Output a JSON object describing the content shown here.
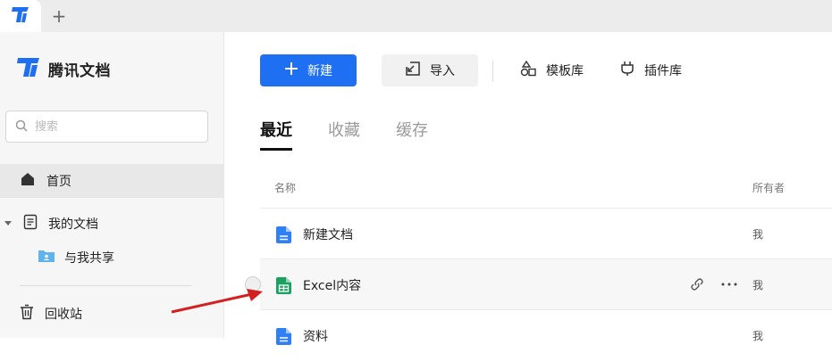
{
  "titlebar": {
    "new_tab_label": "+"
  },
  "sidebar": {
    "brand": "腾讯文档",
    "search_placeholder": "搜索",
    "items": [
      {
        "label": "首页"
      },
      {
        "label": "我的文档"
      },
      {
        "label": "与我共享"
      },
      {
        "label": "回收站"
      }
    ]
  },
  "toolbar": {
    "new_label": "新建",
    "import_label": "导入",
    "templates_label": "模板库",
    "plugins_label": "插件库"
  },
  "tabs": [
    {
      "label": "最近",
      "active": true
    },
    {
      "label": "收藏",
      "active": false
    },
    {
      "label": "缓存",
      "active": false
    }
  ],
  "table": {
    "col_name": "名称",
    "col_owner": "所有者",
    "rows": [
      {
        "name": "新建文档",
        "owner": "我",
        "type": "doc"
      },
      {
        "name": "Excel内容",
        "owner": "我",
        "type": "sheet"
      },
      {
        "name": "资料",
        "owner": "我",
        "type": "doc"
      }
    ]
  },
  "colors": {
    "accent": "#1f6ff2",
    "sheet": "#1aa160",
    "annotation_arrow": "#d32020"
  }
}
